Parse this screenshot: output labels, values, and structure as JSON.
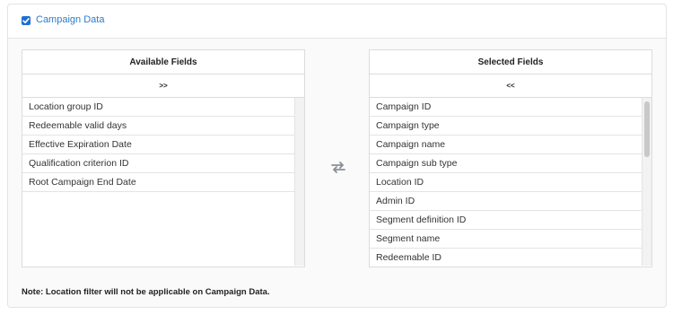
{
  "section": {
    "checkbox_label": "Campaign Data",
    "checked": true
  },
  "available": {
    "title": "Available Fields",
    "move_label": ">>",
    "items": [
      "Location group ID",
      "Redeemable valid days",
      "Effective Expiration Date",
      "Qualification criterion ID",
      "Root Campaign End Date"
    ]
  },
  "selected": {
    "title": "Selected Fields",
    "move_label": "<<",
    "items": [
      "Campaign ID",
      "Campaign type",
      "Campaign name",
      "Campaign sub type",
      "Location ID",
      "Admin ID",
      "Segment definition ID",
      "Segment name",
      "Redeemable ID"
    ]
  },
  "swap_icon": "swap-arrows-icon",
  "note": "Note: Location filter will not be applicable on Campaign Data.",
  "colors": {
    "accent": "#1f6fd1",
    "label_blue": "#2d7cc9",
    "border": "#dcdcdc"
  }
}
